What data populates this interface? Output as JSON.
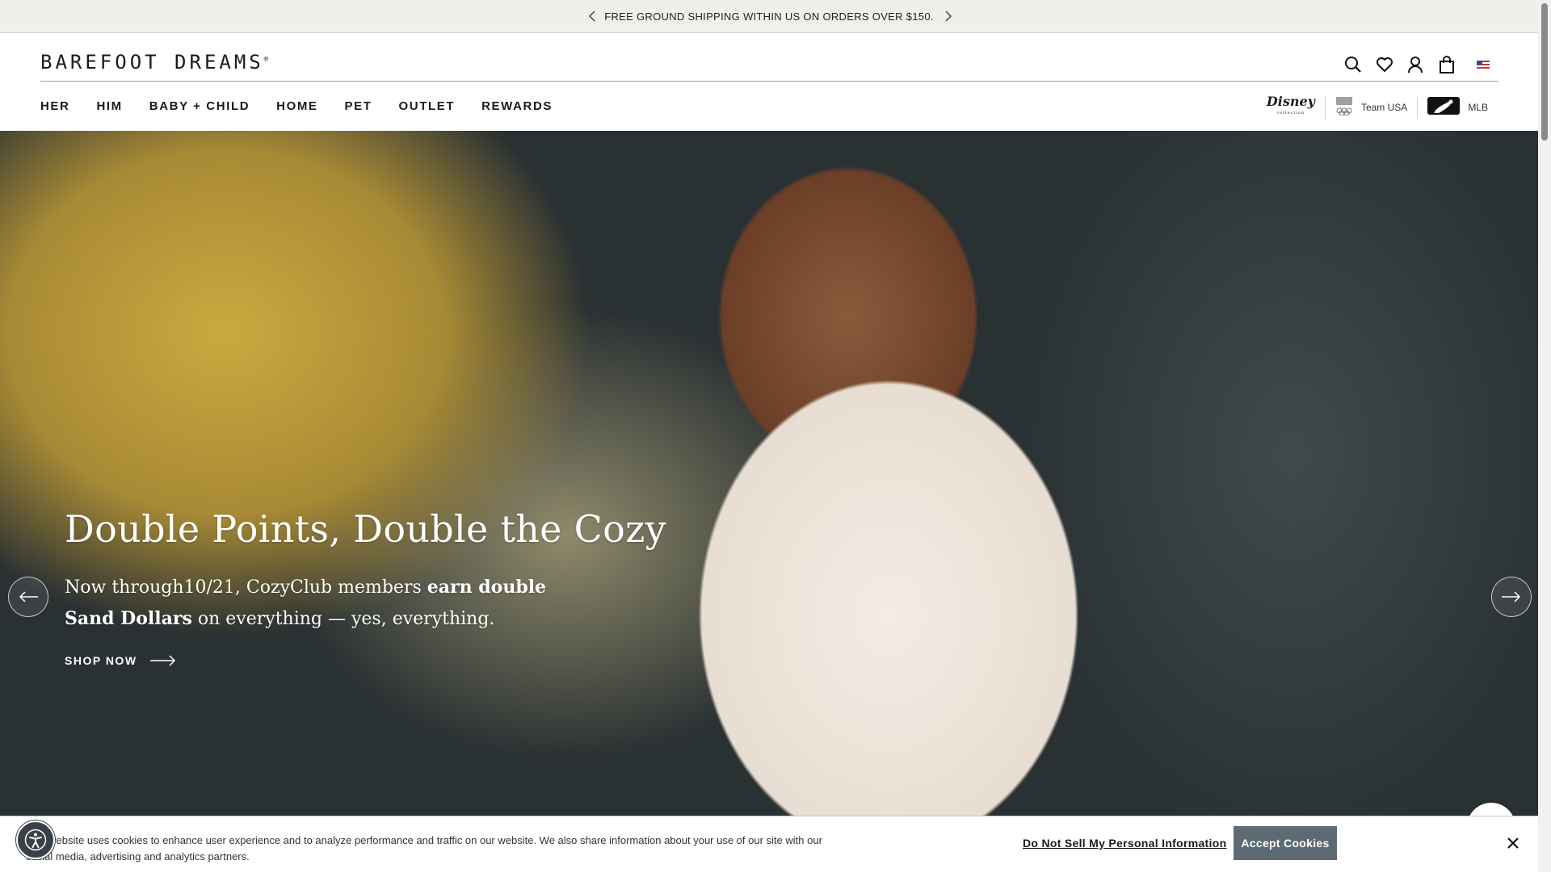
{
  "announcement": {
    "message": "FREE GROUND SHIPPING WITHIN US ON ORDERS OVER $150."
  },
  "header": {
    "logo": "BAREFOOT DREAMS",
    "logo_mark": "®",
    "nav": [
      "HER",
      "HIM",
      "BABY + CHILD",
      "HOME",
      "PET",
      "OUTLET",
      "REWARDS"
    ],
    "partners": {
      "disney": "Disney",
      "disney_sub": "collection",
      "team_usa": "Team USA",
      "mlb": "MLB"
    }
  },
  "hero": {
    "title": "Double Points, Double the Cozy",
    "subtitle_1": "Now through10/21, CozyClub members ",
    "subtitle_bold_1": "earn double",
    "subtitle_bold_2": "Sand Dollars",
    "subtitle_2": " on everything — yes, everything.",
    "cta": "SHOP NOW"
  },
  "cookie_banner": {
    "text": "This website uses cookies to enhance user experience and to analyze performance and traffic on our website. We also share information about your use of our site with our social media, advertising and analytics partners.",
    "do_not_sell": "Do Not Sell My Personal Information",
    "accept": "Accept Cookies"
  },
  "icons": {
    "announcement_prev": "chevron-left-icon",
    "announcement_next": "chevron-right-icon",
    "search": "search-icon",
    "wishlist": "heart-icon",
    "account": "user-icon",
    "cart": "bag-icon",
    "flag": "us-flag-icon",
    "close": "close-icon",
    "accessibility": "accessibility-icon"
  },
  "colors": {
    "announcement_bg": "#f1efeb",
    "accept_button": "#5c6b73",
    "hero_text": "#ffffff"
  }
}
